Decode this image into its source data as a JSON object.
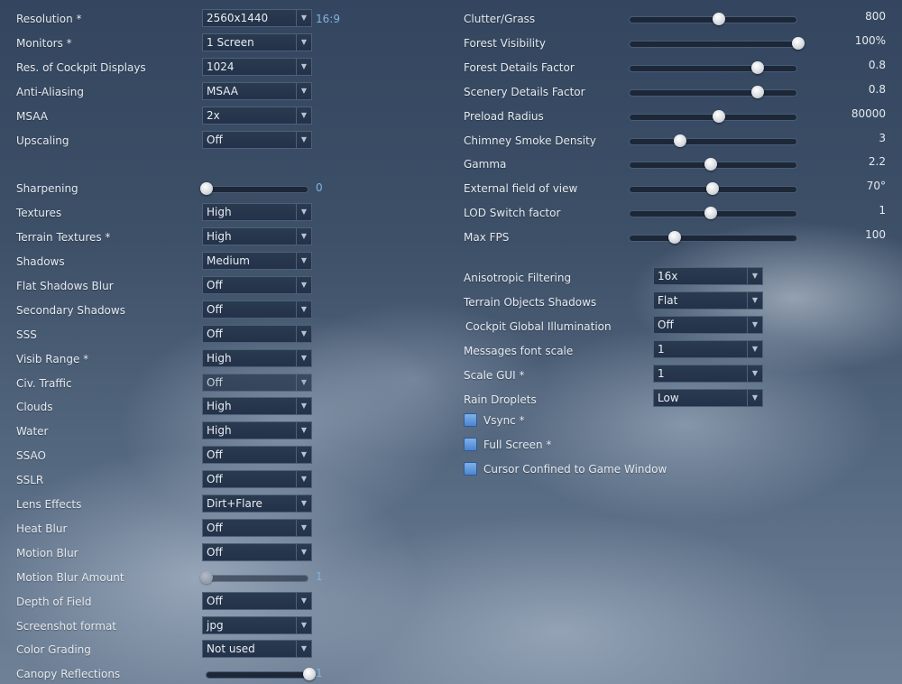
{
  "left": [
    {
      "kind": "dropdown",
      "label": "Resolution *",
      "value": "2560x1440",
      "extra": "16:9"
    },
    {
      "kind": "dropdown",
      "label": "Monitors *",
      "value": "1 Screen"
    },
    {
      "kind": "dropdown",
      "label": "Res. of Cockpit Displays",
      "value": "1024"
    },
    {
      "kind": "dropdown",
      "label": "Anti-Aliasing",
      "value": "MSAA"
    },
    {
      "kind": "dropdown",
      "label": "MSAA",
      "value": "2x"
    },
    {
      "kind": "dropdown",
      "label": "Upscaling",
      "value": "Off"
    },
    {
      "kind": "gap"
    },
    {
      "kind": "slider",
      "label": "Sharpening",
      "value": "0",
      "fraction": 0.0
    },
    {
      "kind": "dropdown",
      "label": "Textures",
      "value": "High"
    },
    {
      "kind": "dropdown",
      "label": "Terrain Textures *",
      "value": "High"
    },
    {
      "kind": "dropdown",
      "label": "Shadows",
      "value": "Medium"
    },
    {
      "kind": "dropdown",
      "label": "Flat Shadows Blur",
      "value": "Off"
    },
    {
      "kind": "dropdown",
      "label": "Secondary Shadows",
      "value": "Off"
    },
    {
      "kind": "dropdown",
      "label": "SSS",
      "value": "Off"
    },
    {
      "kind": "dropdown",
      "label": "Visib Range *",
      "value": "High"
    },
    {
      "kind": "dropdown",
      "label": "Civ. Traffic",
      "value": "Off",
      "disabled": true
    },
    {
      "kind": "dropdown",
      "label": "Clouds",
      "value": "High"
    },
    {
      "kind": "dropdown",
      "label": "Water",
      "value": "High"
    },
    {
      "kind": "dropdown",
      "label": "SSAO",
      "value": "Off"
    },
    {
      "kind": "dropdown",
      "label": "SSLR",
      "value": "Off"
    },
    {
      "kind": "dropdown",
      "label": "Lens Effects",
      "value": "Dirt+Flare"
    },
    {
      "kind": "dropdown",
      "label": "Heat Blur",
      "value": "Off"
    },
    {
      "kind": "dropdown",
      "label": "Motion Blur",
      "value": "Off"
    },
    {
      "kind": "slider",
      "label": "Motion Blur Amount",
      "value": "1",
      "fraction": 0.0,
      "disabled": true
    },
    {
      "kind": "dropdown",
      "label": "Depth of Field",
      "value": "Off"
    },
    {
      "kind": "dropdown",
      "label": "Screenshot format",
      "value": "jpg"
    },
    {
      "kind": "dropdown",
      "label": "Color Grading",
      "value": "Not used"
    },
    {
      "kind": "slider",
      "label": "Canopy Reflections",
      "value": "1",
      "fraction": 1.0
    }
  ],
  "right_sliders": [
    {
      "label": "Clutter/Grass",
      "value": "800",
      "fraction": 0.53
    },
    {
      "label": "Forest Visibility",
      "value": "100%",
      "fraction": 1.0
    },
    {
      "label": "Forest Details Factor",
      "value": "0.8",
      "fraction": 0.76
    },
    {
      "label": "Scenery Details Factor",
      "value": "0.8",
      "fraction": 0.76
    },
    {
      "label": "Preload Radius",
      "value": "80000",
      "fraction": 0.53
    },
    {
      "label": "Chimney Smoke Density",
      "value": "3",
      "fraction": 0.3
    },
    {
      "label": "Gamma",
      "value": "2.2",
      "fraction": 0.48
    },
    {
      "label": "External field of view",
      "value": "70°",
      "fraction": 0.49
    },
    {
      "label": "LOD Switch factor",
      "value": "1",
      "fraction": 0.48
    },
    {
      "label": "Max FPS",
      "value": "100",
      "fraction": 0.27
    }
  ],
  "right_dropdowns": [
    {
      "label": "Anisotropic Filtering",
      "value": "16x"
    },
    {
      "label": "Terrain Objects Shadows",
      "value": "Flat"
    },
    {
      "label": "Cockpit Global Illumination",
      "value": "Off"
    },
    {
      "label": "Messages font scale",
      "value": "1"
    },
    {
      "label": "Scale GUI *",
      "value": "1"
    },
    {
      "label": "Rain Droplets",
      "value": "Low"
    }
  ],
  "checkboxes": [
    {
      "label": "Vsync *",
      "checked": false
    },
    {
      "label": "Full Screen *",
      "checked": false
    },
    {
      "label": "Cursor Confined to Game Window",
      "checked": false
    }
  ],
  "icons": {
    "dropdown_arrow": "chevron-down-icon",
    "dropdown_arrow_glyph": "▼"
  },
  "colors": {
    "accent_value": "#7fb3e0",
    "checkbox": "#5b91d8"
  }
}
